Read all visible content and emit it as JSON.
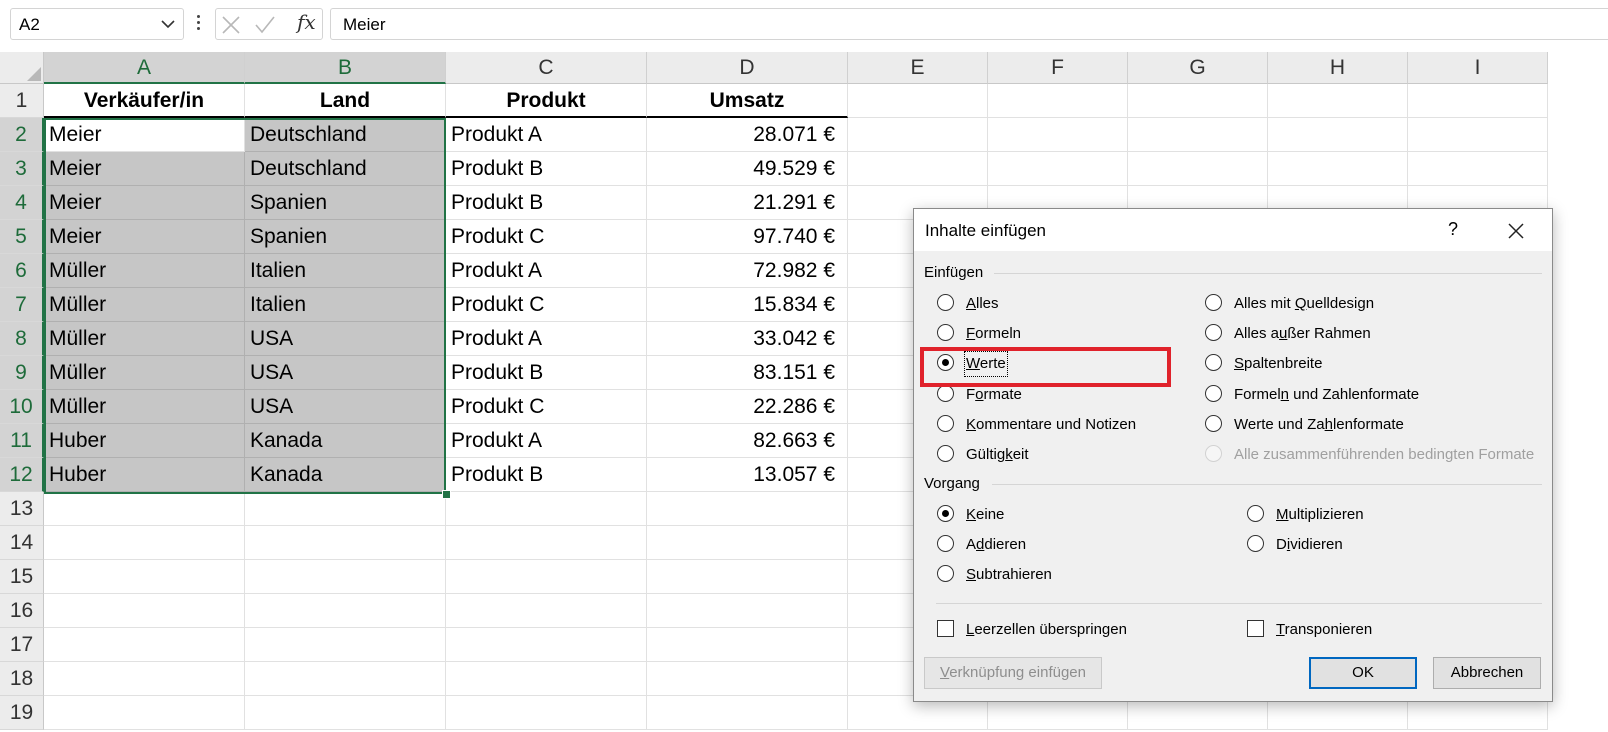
{
  "formula_bar": {
    "name_box": "A2",
    "cancel_icon": "x-icon",
    "enter_icon": "check-icon",
    "fx_label": "fx",
    "value": "Meier"
  },
  "columns": [
    "A",
    "B",
    "C",
    "D",
    "E",
    "F",
    "G",
    "H",
    "I"
  ],
  "rows": [
    "1",
    "2",
    "3",
    "4",
    "5",
    "6",
    "7",
    "8",
    "9",
    "10",
    "11",
    "12",
    "13",
    "14",
    "15",
    "16",
    "17",
    "18",
    "19"
  ],
  "table": {
    "headers": [
      "Verkäufer/in",
      "Land",
      "Produkt",
      "Umsatz"
    ],
    "rows": [
      [
        "Meier",
        "Deutschland",
        "Produkt A",
        "28.071 €"
      ],
      [
        "Meier",
        "Deutschland",
        "Produkt B",
        "49.529 €"
      ],
      [
        "Meier",
        "Spanien",
        "Produkt B",
        "21.291 €"
      ],
      [
        "Meier",
        "Spanien",
        "Produkt C",
        "97.740 €"
      ],
      [
        "Müller",
        "Italien",
        "Produkt A",
        "72.982 €"
      ],
      [
        "Müller",
        "Italien",
        "Produkt C",
        "15.834 €"
      ],
      [
        "Müller",
        "USA",
        "Produkt A",
        "33.042 €"
      ],
      [
        "Müller",
        "USA",
        "Produkt B",
        "83.151 €"
      ],
      [
        "Müller",
        "USA",
        "Produkt C",
        "22.286 €"
      ],
      [
        "Huber",
        "Kanada",
        "Produkt A",
        "82.663 €"
      ],
      [
        "Huber",
        "Kanada",
        "Produkt B",
        "13.057 €"
      ]
    ]
  },
  "dialog": {
    "title": "Inhalte einfügen",
    "help": "?",
    "group_paste": "Einfügen",
    "paste_left": [
      {
        "pre": "",
        "ul": "A",
        "post": "lles",
        "checked": false
      },
      {
        "pre": "",
        "ul": "F",
        "post": "ormeln",
        "checked": false
      },
      {
        "pre": "",
        "ul": "W",
        "post": "erte",
        "checked": true
      },
      {
        "pre": "F",
        "ul": "o",
        "post": "rmate",
        "checked": false
      },
      {
        "pre": "",
        "ul": "K",
        "post": "ommentare und Notizen",
        "checked": false
      },
      {
        "pre": "Gültig",
        "ul": "k",
        "post": "eit",
        "checked": false
      }
    ],
    "paste_right": [
      {
        "pre": "Alles mit ",
        "ul": "Q",
        "post": "uelldesign",
        "checked": false,
        "disabled": false
      },
      {
        "pre": "Alles a",
        "ul": "u",
        "post": "ßer Rahmen",
        "checked": false,
        "disabled": false
      },
      {
        "pre": "",
        "ul": "S",
        "post": "paltenbreite",
        "checked": false,
        "disabled": false
      },
      {
        "pre": "Formel",
        "ul": "n",
        "post": " und Zahlenformate",
        "checked": false,
        "disabled": false
      },
      {
        "pre": "Werte und Za",
        "ul": "h",
        "post": "lenformate",
        "checked": false,
        "disabled": false
      },
      {
        "pre": "Alle zusammenführenden bedingten Formate",
        "ul": "",
        "post": "",
        "checked": false,
        "disabled": true
      }
    ],
    "group_operation": "Vorgang",
    "op_left": [
      {
        "pre": "",
        "ul": "K",
        "post": "eine",
        "checked": true
      },
      {
        "pre": "A",
        "ul": "d",
        "post": "dieren",
        "checked": false
      },
      {
        "pre": "",
        "ul": "S",
        "post": "ubtrahieren",
        "checked": false
      }
    ],
    "op_right": [
      {
        "pre": "",
        "ul": "M",
        "post": "ultiplizieren",
        "checked": false
      },
      {
        "pre": "D",
        "ul": "i",
        "post": "vidieren",
        "checked": false
      }
    ],
    "skip_blanks": {
      "pre": "",
      "ul": "L",
      "post": "eerzellen überspringen",
      "checked": false
    },
    "transpose": {
      "pre": "",
      "ul": "T",
      "post": "ransponieren",
      "checked": false
    },
    "link_button": {
      "pre": "",
      "ul": "V",
      "post": "erknüpfung einfügen"
    },
    "ok": "OK",
    "cancel": "Abbrechen"
  },
  "colors": {
    "selection_green": "#217346",
    "highlight_red": "#e0222b",
    "selected_fill": "#c6c6c6"
  }
}
